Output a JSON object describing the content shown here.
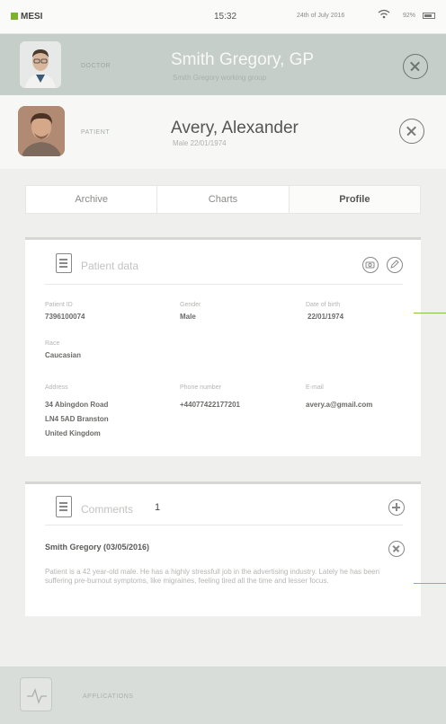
{
  "status_bar": {
    "carrier": "MESI",
    "time": "15:32",
    "date": "24th of July 2016",
    "battery": "92%"
  },
  "doctor": {
    "role_label": "DOCTOR",
    "name": "Smith Gregory, GP",
    "subtitle": "Smith Gregory working group"
  },
  "patient": {
    "role_label": "PATIENT",
    "name": "Avery, Alexander",
    "subtitle": "Male 22/01/1974"
  },
  "tabs": [
    {
      "label": "Archive",
      "active": false
    },
    {
      "label": "Charts",
      "active": false
    },
    {
      "label": "Profile",
      "active": true
    }
  ],
  "patient_data": {
    "title": "Patient data",
    "fields": {
      "patient_id": {
        "label": "Patient ID",
        "value": "7396100074"
      },
      "gender": {
        "label": "Gender",
        "value": "Male"
      },
      "dob": {
        "label": "Date of birth",
        "value": "22/01/1974"
      },
      "race": {
        "label": "Race",
        "value": "Caucasian"
      },
      "address": {
        "label": "Address",
        "line1": "34 Abingdon Road",
        "line2": "LN4 5AD Branston",
        "line3": "United Kingdom"
      },
      "phone": {
        "label": "Phone number",
        "value": "+44077422177201"
      },
      "email": {
        "label": "E-mail",
        "value": "avery.a@gmail.com"
      }
    }
  },
  "comments": {
    "title": "Comments",
    "count": "1",
    "items": [
      {
        "author": "Smith Gregory (03/05/2016)",
        "text": "Patient is a 42 year-old male. He has a highly stressfull job in the advertising industry. Lately he has been suffering pre-burnout symptoms, like migraines, feeling tired all the time and lesser focus."
      }
    ]
  },
  "footer": {
    "label": "APPLICATIONS"
  },
  "colors": {
    "doctor_bar": "#c6cec9",
    "accent_green": "#7bb32e",
    "marker_green": "#8fbf4a"
  }
}
